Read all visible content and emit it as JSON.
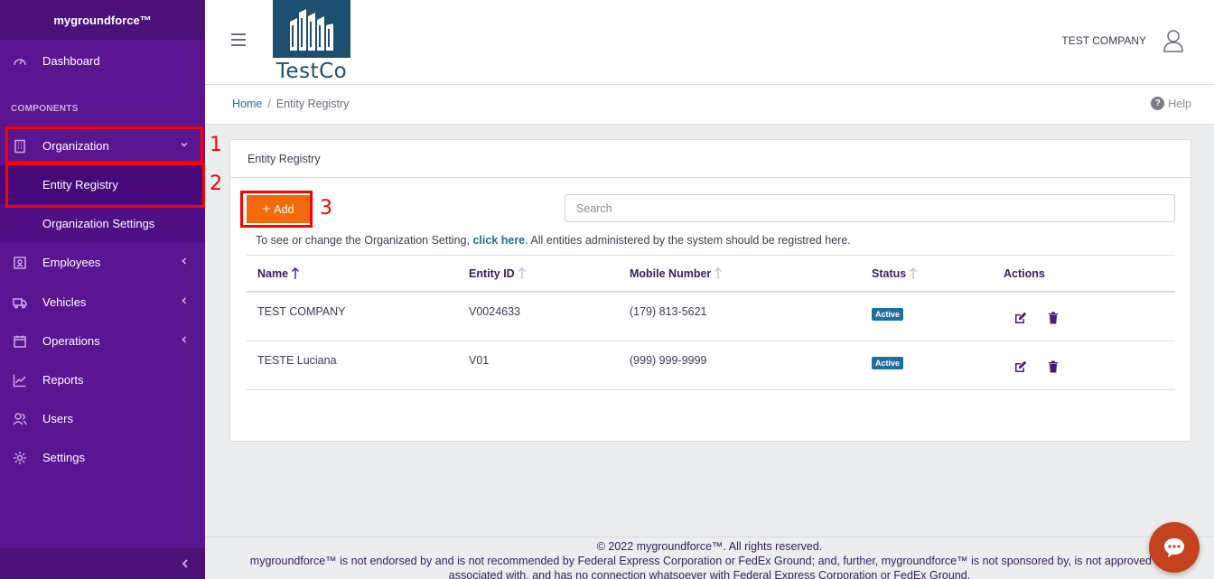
{
  "sidebar": {
    "brand": "mygroundforce™",
    "dashboard": "Dashboard",
    "section_components": "COMPONENTS",
    "organization": "Organization",
    "entity_registry": "Entity Registry",
    "organization_settings": "Organization Settings",
    "employees": "Employees",
    "vehicles": "Vehicles",
    "operations": "Operations",
    "reports": "Reports",
    "users": "Users",
    "settings": "Settings"
  },
  "annotations": [
    "1",
    "2",
    "3"
  ],
  "header": {
    "logo_text": "TestCo",
    "company": "TEST COMPANY"
  },
  "breadcrumb": {
    "home": "Home",
    "separator": "/",
    "current": "Entity Registry",
    "help": "Help"
  },
  "card": {
    "title": "Entity Registry",
    "add_label": "Add",
    "search_placeholder": "Search",
    "note_before": "To see or change the Organization Setting,",
    "note_link": "click here",
    "note_after": ". All entities administered by the system should be registred here."
  },
  "table": {
    "headers": {
      "name": "Name",
      "entity_id": "Entity ID",
      "mobile": "Mobile Number",
      "status": "Status",
      "actions": "Actions"
    },
    "rows": [
      {
        "name": "TEST COMPANY",
        "entity_id": "V0024633",
        "mobile": "(179) 813-5621",
        "status": "Active"
      },
      {
        "name": "TESTE Luciana",
        "entity_id": "V01",
        "mobile": "(999) 999-9999",
        "status": "Active"
      }
    ]
  },
  "footer": {
    "line1": "© 2022 mygroundforce™. All rights reserved.",
    "line2": "mygroundforce™ is not endorsed by and is not recommended by Federal Express Corporation or FedEx Ground; and, further, mygroundforce™ is not sponsored by, is not approved by,",
    "line3": "associated with, and has no connection whatsoever with Federal Express Corporation or FedEx Ground."
  },
  "colors": {
    "sidebar": "#5a1591",
    "accent_orange": "#f26a0b",
    "link_teal": "#1f6f8b",
    "badge_blue": "#1f6f9b",
    "highlight_red": "#ff0000"
  }
}
